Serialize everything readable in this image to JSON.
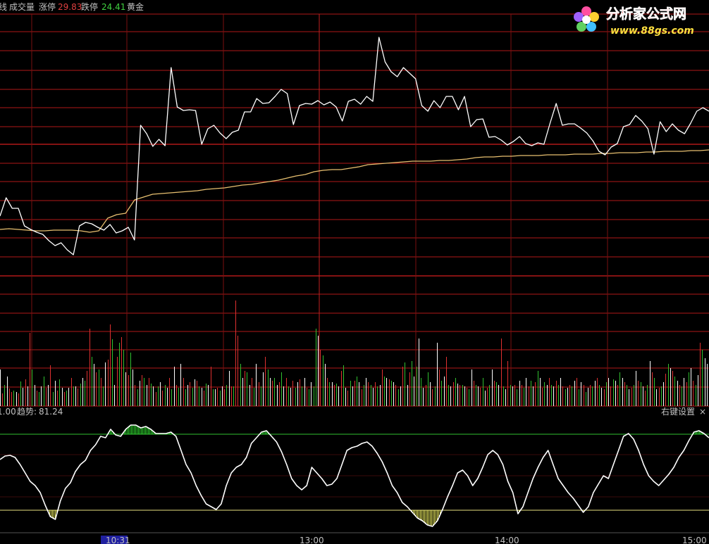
{
  "header": {
    "prefix": "线",
    "volume_label": "成交量",
    "limit_up_label": "涨停",
    "limit_up_value": "29.83",
    "limit_down_label": "跌停",
    "limit_down_value": "24.41",
    "gold_label": "黄金"
  },
  "logo": {
    "title": "分析家公式网",
    "url": "www.88gs.com"
  },
  "indicator": {
    "left_value": "1.00",
    "trend_label": "趋势:",
    "trend_value": "81.24",
    "settings_label": "右键设置",
    "close_label": "×"
  },
  "time_axis": {
    "ticks": [
      "10:31",
      "13:00",
      "14:00",
      "15:00"
    ]
  },
  "colors": {
    "background": "#000000",
    "grid_red": "#b01818",
    "grid_vertical": "#7a1010",
    "price_line": "#ffffff",
    "avg_line": "#e8c070",
    "vol_up": "#e03030",
    "vol_down": "#30c030",
    "vol_flat": "#ffffff",
    "osc_line": "#ffffff",
    "osc_hi_fill": "#30e030",
    "osc_lo_fill": "#f0f060",
    "upper_band": "#30c030",
    "lower_band": "#e8e080",
    "limit_up_text": "#e04040",
    "limit_down_text": "#40d040",
    "label_text": "#c0c0c0",
    "time_tick_highlight": "#2020a0"
  },
  "chart_data": [
    {
      "type": "line",
      "name": "intraday price",
      "values": [
        307,
        281,
        296,
        296,
        321,
        326,
        330,
        333,
        342,
        349,
        345,
        355,
        362,
        321,
        316,
        318,
        323,
        327,
        319,
        331,
        328,
        323,
        341,
        178,
        190,
        208,
        198,
        207,
        96,
        152,
        157,
        156,
        157,
        205,
        183,
        178,
        189,
        197,
        188,
        185,
        159,
        159,
        140,
        147,
        146,
        137,
        127,
        133,
        177,
        150,
        147,
        148,
        143,
        149,
        145,
        152,
        172,
        144,
        141,
        148,
        137,
        144,
        53,
        88,
        102,
        109,
        96,
        104,
        112,
        150,
        158,
        143,
        153,
        137,
        137,
        156,
        137,
        180,
        170,
        169,
        195,
        194,
        199,
        206,
        201,
        194,
        204,
        207,
        203,
        205,
        175,
        147,
        178,
        176,
        176,
        182,
        189,
        200,
        215,
        220,
        209,
        204,
        180,
        177,
        164,
        172,
        183,
        219,
        173,
        187,
        176,
        185,
        190,
        175,
        158,
        153,
        158
      ],
      "avg_values": [
        326,
        325,
        326,
        327,
        328,
        328,
        327,
        327,
        327,
        328,
        330,
        328,
        310,
        305,
        303,
        284,
        280,
        276,
        275,
        274,
        273,
        272,
        271,
        269,
        268,
        267,
        265,
        263,
        262,
        260,
        258,
        256,
        253,
        250,
        248,
        244,
        242,
        241,
        241,
        239,
        237,
        234,
        233,
        232,
        231,
        230,
        229,
        229,
        229,
        228,
        228,
        227,
        226,
        224,
        223,
        223,
        222,
        222,
        221,
        221,
        221,
        220,
        220,
        220,
        219,
        219,
        219,
        218,
        218,
        217,
        217,
        217,
        216,
        216,
        215,
        215,
        215,
        214,
        214,
        213
      ]
    },
    {
      "type": "bar",
      "name": "volume",
      "values": [
        52,
        18,
        30,
        42,
        25,
        20,
        22,
        20,
        18,
        35,
        26,
        38,
        28,
        104,
        52,
        30,
        22,
        20,
        28,
        42,
        26,
        30,
        58,
        20,
        36,
        22,
        38,
        26,
        20,
        22,
        26,
        40,
        28,
        28,
        25,
        32,
        40,
        36,
        50,
        110,
        70,
        60,
        48,
        52,
        40,
        28,
        62,
        66,
        116,
        95,
        30,
        70,
        90,
        98,
        80,
        48,
        44,
        76,
        52,
        30,
        24,
        36,
        44,
        40,
        30,
        40,
        32,
        28,
        20,
        28,
        34,
        22,
        30,
        26,
        40,
        24,
        56,
        30,
        26,
        60,
        40,
        24,
        30,
        34,
        26,
        38,
        36,
        28,
        26,
        22,
        32,
        30,
        56,
        24,
        24,
        26,
        22,
        28,
        24,
        30,
        50,
        28,
        28,
        150,
        100,
        60,
        40,
        50,
        48,
        30,
        40,
        26,
        60,
        34,
        28,
        48,
        70,
        52,
        40,
        36,
        40,
        30,
        34,
        48,
        28,
        40,
        28,
        26,
        36,
        26,
        34,
        38,
        28,
        40,
        26,
        24,
        34,
        28,
        110,
        100,
        80,
        72,
        60,
        40,
        34,
        34,
        30,
        32,
        28,
        50,
        58,
        26,
        22,
        36,
        28,
        36,
        42,
        34,
        24,
        30,
        40,
        34,
        30,
        26,
        34,
        28,
        30,
        52,
        42,
        40,
        38,
        36,
        34,
        30,
        24,
        28,
        56,
        62,
        30,
        48,
        64,
        42,
        56,
        96,
        40,
        26,
        30,
        48,
        34,
        24,
        28,
        90,
        52,
        36,
        42,
        70,
        30,
        28,
        34,
        40,
        32,
        30,
        30,
        28,
        26,
        24,
        52,
        36,
        30,
        28,
        26,
        40,
        22,
        26,
        30,
        52,
        36,
        34,
        30,
        96,
        28,
        24,
        64,
        30,
        28,
        30,
        24,
        36,
        30,
        26,
        40,
        28,
        36,
        28,
        34,
        50,
        40,
        26,
        34,
        30,
        40,
        30,
        28,
        36,
        30,
        40,
        28,
        24,
        26,
        30,
        28,
        36,
        40,
        24,
        34,
        30,
        20,
        26,
        30,
        28,
        36,
        40,
        30,
        26,
        24,
        34,
        40,
        28,
        38,
        36,
        30,
        48,
        40,
        34,
        30,
        24,
        26,
        30,
        50,
        36,
        34,
        28,
        22,
        30,
        64,
        48,
        40,
        24,
        26,
        28,
        34,
        46,
        60,
        54,
        50,
        42,
        36,
        30,
        28,
        40,
        34,
        48,
        54,
        36,
        30,
        44,
        90,
        80,
        68,
        60
      ],
      "colors": [
        "w",
        "r",
        "g",
        "w",
        "r",
        "r",
        "g",
        "w",
        "r",
        "g",
        "w",
        "r",
        "w",
        "r",
        "g",
        "w",
        "r",
        "g",
        "w",
        "g",
        "r",
        "w",
        "r",
        "g",
        "w",
        "r",
        "g",
        "w",
        "r",
        "g",
        "w",
        "r",
        "g",
        "w",
        "r",
        "g",
        "w",
        "g",
        "r",
        "r",
        "g",
        "w",
        "r",
        "g",
        "r",
        "g",
        "w",
        "r",
        "r",
        "g",
        "w",
        "r",
        "g",
        "r",
        "g",
        "w",
        "r",
        "g",
        "w",
        "r",
        "g",
        "w",
        "r",
        "g",
        "w",
        "r",
        "g",
        "w",
        "r",
        "g",
        "w",
        "r",
        "g",
        "w",
        "r",
        "g",
        "w",
        "r",
        "g",
        "w",
        "r",
        "g",
        "w",
        "r",
        "g",
        "w",
        "r",
        "g",
        "w",
        "r",
        "g",
        "w",
        "r",
        "g",
        "w",
        "r",
        "g",
        "w",
        "r",
        "g",
        "w",
        "r",
        "g",
        "r",
        "r",
        "g",
        "w",
        "r",
        "g",
        "w",
        "r",
        "g",
        "w",
        "r",
        "g",
        "w",
        "r",
        "g",
        "w",
        "r",
        "g",
        "w",
        "r",
        "g",
        "w",
        "r",
        "g",
        "w",
        "r",
        "g",
        "w",
        "r",
        "g",
        "w",
        "r",
        "g",
        "w",
        "g",
        "g",
        "w",
        "r",
        "g",
        "w",
        "r",
        "g",
        "w",
        "r",
        "g",
        "w",
        "r",
        "g",
        "w",
        "r",
        "g",
        "w",
        "r",
        "g",
        "w",
        "r",
        "g",
        "w",
        "r",
        "g",
        "w",
        "r",
        "g",
        "w",
        "r",
        "g",
        "w",
        "r",
        "g",
        "w",
        "r",
        "g",
        "w",
        "r",
        "g",
        "w",
        "r",
        "g",
        "w",
        "g",
        "w",
        "g",
        "w",
        "r",
        "g",
        "w",
        "r",
        "g",
        "w",
        "r",
        "g",
        "w",
        "r",
        "g",
        "w",
        "r",
        "g",
        "w",
        "r",
        "g",
        "w",
        "r",
        "g",
        "w",
        "r",
        "g",
        "w",
        "r",
        "g",
        "w",
        "r",
        "g",
        "w",
        "r",
        "g",
        "w",
        "r",
        "g",
        "w",
        "r",
        "g",
        "w",
        "r",
        "g",
        "w",
        "r",
        "g",
        "w",
        "r",
        "g",
        "w",
        "r",
        "g",
        "w",
        "r",
        "g",
        "w",
        "r",
        "g",
        "w",
        "r",
        "g",
        "w",
        "r",
        "g",
        "w",
        "r",
        "g",
        "w",
        "r",
        "g",
        "w",
        "r",
        "g",
        "w",
        "r",
        "g",
        "w",
        "r",
        "g",
        "w",
        "r",
        "g",
        "w",
        "r",
        "g",
        "w",
        "r",
        "g",
        "w",
        "r",
        "g",
        "w",
        "r",
        "g",
        "w",
        "r",
        "g",
        "w",
        "r",
        "g",
        "w",
        "r",
        "g",
        "w",
        "r",
        "g",
        "w",
        "r",
        "g",
        "w",
        "r",
        "g",
        "w",
        "r",
        "g",
        "w",
        "r",
        "g",
        "w",
        "r",
        "g",
        "w",
        "r",
        "g",
        "w"
      ]
    },
    {
      "type": "line",
      "name": "趋势",
      "values": [
        653,
        648,
        647,
        650,
        660,
        672,
        684,
        690,
        700,
        718,
        734,
        738,
        712,
        694,
        686,
        670,
        660,
        654,
        640,
        632,
        620,
        622,
        610,
        618,
        620,
        610,
        604,
        604,
        608,
        606,
        610,
        616,
        616,
        616,
        614,
        620,
        640,
        660,
        672,
        690,
        704,
        716,
        720,
        724,
        716,
        690,
        672,
        664,
        660,
        650,
        630,
        622,
        614,
        612,
        620,
        628,
        642,
        660,
        680,
        690,
        696,
        690,
        664,
        672,
        680,
        690,
        688,
        680,
        660,
        640,
        636,
        634,
        630,
        628,
        634,
        644,
        656,
        672,
        690,
        700,
        714,
        720,
        728,
        736,
        740,
        746,
        748,
        740,
        724,
        706,
        690,
        672,
        668,
        676,
        690,
        680,
        664,
        646,
        640,
        646,
        660,
        684,
        700,
        730,
        720,
        700,
        680,
        664,
        650,
        640,
        660,
        680,
        690,
        700,
        708,
        718,
        728,
        720,
        700,
        688,
        676,
        680,
        660,
        640,
        620,
        616,
        624,
        640,
        660,
        676,
        684,
        690,
        682,
        674,
        664,
        650,
        640,
        626,
        614,
        612,
        616,
        622
      ]
    }
  ]
}
